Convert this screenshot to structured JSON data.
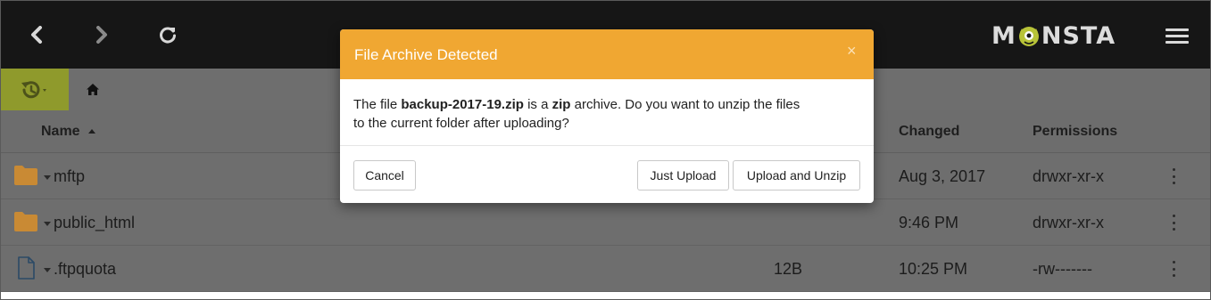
{
  "brand": {
    "logo_text_left": "M",
    "logo_text_right": "NSTA"
  },
  "colors": {
    "topbar": "#161616",
    "dimmed_row": "#6e6e6e",
    "history_button": "#8f9a2c",
    "modal_header": "#f0a732",
    "folder": "#c98a34"
  },
  "toolbar": {
    "back_icon": "chevron-left-icon",
    "forward_icon": "chevron-right-icon",
    "refresh_icon": "refresh-icon",
    "menu_icon": "hamburger-menu-icon"
  },
  "breadcrumb": {
    "history_icon": "history-icon",
    "home_icon": "home-icon"
  },
  "table": {
    "headers": {
      "name": "Name",
      "changed": "Changed",
      "permissions": "Permissions"
    },
    "sort": "name-ascending",
    "rows": [
      {
        "type": "folder",
        "name": "mftp",
        "size": "",
        "changed": "Aug 3, 2017",
        "permissions": "drwxr-xr-x"
      },
      {
        "type": "folder",
        "name": "public_html",
        "size": "",
        "changed": "9:46 PM",
        "permissions": "drwxr-xr-x"
      },
      {
        "type": "file",
        "name": ".ftpquota",
        "size": "12B",
        "changed": "10:25 PM",
        "permissions": "-rw-------"
      }
    ]
  },
  "modal": {
    "title": "File Archive Detected",
    "close_label": "×",
    "body_prefix": "The file ",
    "filename": "backup-2017-19.zip",
    "body_middle": " is a ",
    "archive_type": "zip",
    "body_suffix_line1": " archive. Do you want to unzip the files",
    "body_line2": "to the current folder after uploading?",
    "buttons": {
      "cancel": "Cancel",
      "just_upload": "Just Upload",
      "upload_unzip": "Upload and Unzip"
    }
  }
}
